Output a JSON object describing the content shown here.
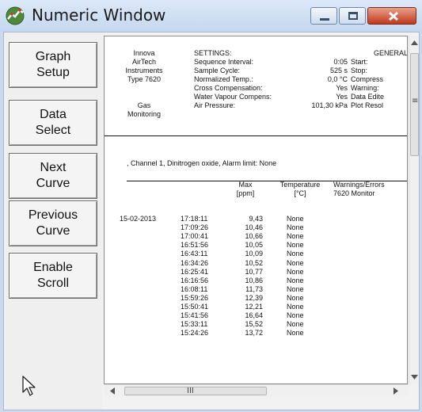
{
  "window": {
    "title": "Numeric Window"
  },
  "buttons": [
    {
      "label": "Graph\nSetup"
    },
    {
      "label": "Data\nSelect"
    },
    {
      "label": "Next\nCurve"
    },
    {
      "label": "Previous\nCurve"
    },
    {
      "label": "Enable\nScroll"
    }
  ],
  "report": {
    "company": [
      "Innova",
      "AirTech",
      "Instruments",
      "Type 7620"
    ],
    "gas": [
      "Gas",
      "Monitoring"
    ],
    "settings_title": "SETTINGS:",
    "settings_labels": [
      "Sequence Interval:",
      "Sample Cycle:",
      "Normalized Temp.:",
      "Cross Compensation:",
      "Water Vapour Compens:",
      "Air Pressure:"
    ],
    "settings_values": [
      "0:05",
      "525 s",
      "0,0 °C",
      "Yes",
      "Yes",
      "101,30 kPa"
    ],
    "general_title": "GENERAL",
    "general_labels": [
      "Start:",
      "Stop:",
      "Compress",
      "Warning:",
      "Data Edite",
      "Plot Resol"
    ],
    "channel": ", Channel 1, Dinitrogen oxide, Alarm limit: None",
    "headers": {
      "max": "Max",
      "max_unit": "[ppm]",
      "temperature": "Temperature",
      "temp_unit": "[°C]",
      "warnings": "Warnings/Errors",
      "warn_sub": "7620  Monitor"
    },
    "date": "15-02-2013",
    "rows": [
      {
        "time": "17:18:11",
        "max": "9,43",
        "temp": "None"
      },
      {
        "time": "17:09:26",
        "max": "10,46",
        "temp": "None"
      },
      {
        "time": "17:00:41",
        "max": "10,66",
        "temp": "None"
      },
      {
        "time": "16:51:56",
        "max": "10,05",
        "temp": "None"
      },
      {
        "time": "16:43:11",
        "max": "10,09",
        "temp": "None"
      },
      {
        "time": "16:34:26",
        "max": "10,52",
        "temp": "None"
      },
      {
        "time": "16:25:41",
        "max": "10,77",
        "temp": "None"
      },
      {
        "time": "16:16:56",
        "max": "10,86",
        "temp": "None"
      },
      {
        "time": "16:08:11",
        "max": "11,73",
        "temp": "None"
      },
      {
        "time": "15:59:26",
        "max": "12,39",
        "temp": "None"
      },
      {
        "time": "15:50:41",
        "max": "12,21",
        "temp": "None"
      },
      {
        "time": "15:41:56",
        "max": "16,64",
        "temp": "None"
      },
      {
        "time": "15:33:11",
        "max": "15,52",
        "temp": "None"
      },
      {
        "time": "15:24:26",
        "max": "13,72",
        "temp": "None"
      }
    ]
  },
  "scrollbar": {
    "h_thumb_grip": "III"
  }
}
